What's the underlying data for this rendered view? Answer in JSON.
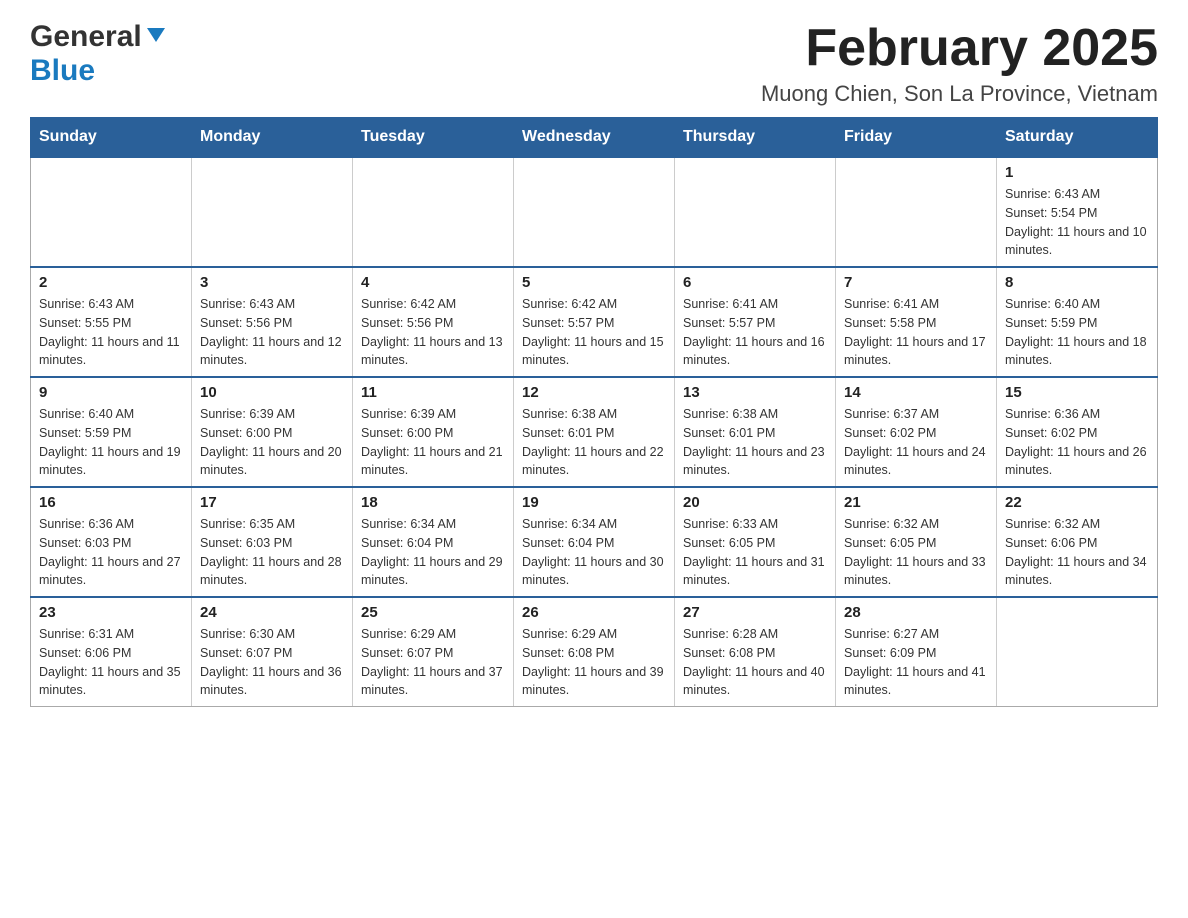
{
  "header": {
    "logo_general": "General",
    "logo_blue": "Blue",
    "title": "February 2025",
    "subtitle": "Muong Chien, Son La Province, Vietnam"
  },
  "calendar": {
    "days_of_week": [
      "Sunday",
      "Monday",
      "Tuesday",
      "Wednesday",
      "Thursday",
      "Friday",
      "Saturday"
    ],
    "weeks": [
      [
        {
          "day": "",
          "info": ""
        },
        {
          "day": "",
          "info": ""
        },
        {
          "day": "",
          "info": ""
        },
        {
          "day": "",
          "info": ""
        },
        {
          "day": "",
          "info": ""
        },
        {
          "day": "",
          "info": ""
        },
        {
          "day": "1",
          "info": "Sunrise: 6:43 AM\nSunset: 5:54 PM\nDaylight: 11 hours and 10 minutes."
        }
      ],
      [
        {
          "day": "2",
          "info": "Sunrise: 6:43 AM\nSunset: 5:55 PM\nDaylight: 11 hours and 11 minutes."
        },
        {
          "day": "3",
          "info": "Sunrise: 6:43 AM\nSunset: 5:56 PM\nDaylight: 11 hours and 12 minutes."
        },
        {
          "day": "4",
          "info": "Sunrise: 6:42 AM\nSunset: 5:56 PM\nDaylight: 11 hours and 13 minutes."
        },
        {
          "day": "5",
          "info": "Sunrise: 6:42 AM\nSunset: 5:57 PM\nDaylight: 11 hours and 15 minutes."
        },
        {
          "day": "6",
          "info": "Sunrise: 6:41 AM\nSunset: 5:57 PM\nDaylight: 11 hours and 16 minutes."
        },
        {
          "day": "7",
          "info": "Sunrise: 6:41 AM\nSunset: 5:58 PM\nDaylight: 11 hours and 17 minutes."
        },
        {
          "day": "8",
          "info": "Sunrise: 6:40 AM\nSunset: 5:59 PM\nDaylight: 11 hours and 18 minutes."
        }
      ],
      [
        {
          "day": "9",
          "info": "Sunrise: 6:40 AM\nSunset: 5:59 PM\nDaylight: 11 hours and 19 minutes."
        },
        {
          "day": "10",
          "info": "Sunrise: 6:39 AM\nSunset: 6:00 PM\nDaylight: 11 hours and 20 minutes."
        },
        {
          "day": "11",
          "info": "Sunrise: 6:39 AM\nSunset: 6:00 PM\nDaylight: 11 hours and 21 minutes."
        },
        {
          "day": "12",
          "info": "Sunrise: 6:38 AM\nSunset: 6:01 PM\nDaylight: 11 hours and 22 minutes."
        },
        {
          "day": "13",
          "info": "Sunrise: 6:38 AM\nSunset: 6:01 PM\nDaylight: 11 hours and 23 minutes."
        },
        {
          "day": "14",
          "info": "Sunrise: 6:37 AM\nSunset: 6:02 PM\nDaylight: 11 hours and 24 minutes."
        },
        {
          "day": "15",
          "info": "Sunrise: 6:36 AM\nSunset: 6:02 PM\nDaylight: 11 hours and 26 minutes."
        }
      ],
      [
        {
          "day": "16",
          "info": "Sunrise: 6:36 AM\nSunset: 6:03 PM\nDaylight: 11 hours and 27 minutes."
        },
        {
          "day": "17",
          "info": "Sunrise: 6:35 AM\nSunset: 6:03 PM\nDaylight: 11 hours and 28 minutes."
        },
        {
          "day": "18",
          "info": "Sunrise: 6:34 AM\nSunset: 6:04 PM\nDaylight: 11 hours and 29 minutes."
        },
        {
          "day": "19",
          "info": "Sunrise: 6:34 AM\nSunset: 6:04 PM\nDaylight: 11 hours and 30 minutes."
        },
        {
          "day": "20",
          "info": "Sunrise: 6:33 AM\nSunset: 6:05 PM\nDaylight: 11 hours and 31 minutes."
        },
        {
          "day": "21",
          "info": "Sunrise: 6:32 AM\nSunset: 6:05 PM\nDaylight: 11 hours and 33 minutes."
        },
        {
          "day": "22",
          "info": "Sunrise: 6:32 AM\nSunset: 6:06 PM\nDaylight: 11 hours and 34 minutes."
        }
      ],
      [
        {
          "day": "23",
          "info": "Sunrise: 6:31 AM\nSunset: 6:06 PM\nDaylight: 11 hours and 35 minutes."
        },
        {
          "day": "24",
          "info": "Sunrise: 6:30 AM\nSunset: 6:07 PM\nDaylight: 11 hours and 36 minutes."
        },
        {
          "day": "25",
          "info": "Sunrise: 6:29 AM\nSunset: 6:07 PM\nDaylight: 11 hours and 37 minutes."
        },
        {
          "day": "26",
          "info": "Sunrise: 6:29 AM\nSunset: 6:08 PM\nDaylight: 11 hours and 39 minutes."
        },
        {
          "day": "27",
          "info": "Sunrise: 6:28 AM\nSunset: 6:08 PM\nDaylight: 11 hours and 40 minutes."
        },
        {
          "day": "28",
          "info": "Sunrise: 6:27 AM\nSunset: 6:09 PM\nDaylight: 11 hours and 41 minutes."
        },
        {
          "day": "",
          "info": ""
        }
      ]
    ]
  }
}
